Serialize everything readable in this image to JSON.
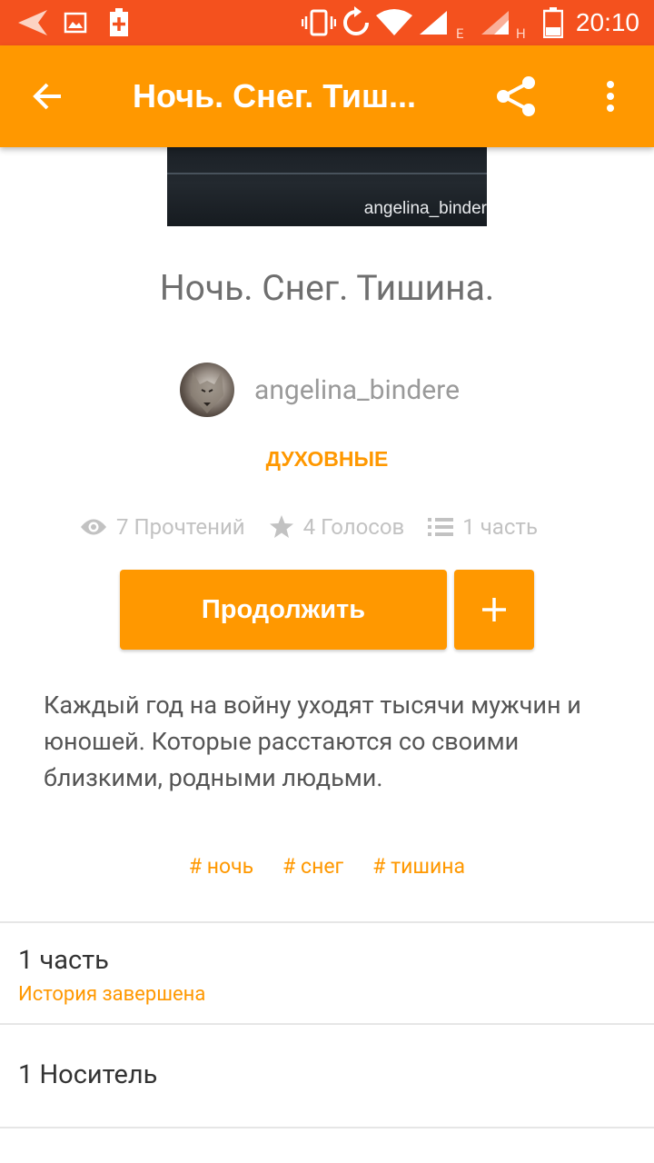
{
  "status_bar": {
    "time": "20:10",
    "network_1": "E",
    "network_2": "H"
  },
  "app_bar": {
    "title": "Ночь. Снег. Тиш..."
  },
  "cover": {
    "watermark": "angelina_binder"
  },
  "story": {
    "title": "Ночь. Снег. Тишина.",
    "author": "angelina_bindere",
    "genre": "ДУХОВНЫЕ",
    "stats": {
      "reads": "7 Прочтений",
      "votes": "4 Голосов",
      "parts": "1 часть"
    },
    "continue_label": "Продолжить",
    "description": "Каждый год на войну уходят тысячи мужчин и юношей. Которые расстаются со своими близкими, родными людьми.",
    "tags": [
      "# ночь",
      "# снег",
      "# тишина"
    ]
  },
  "details": {
    "parts_title": "1 часть",
    "parts_status": "История завершена",
    "carrier": "1 Носитель"
  },
  "colors": {
    "accent": "#ff9800",
    "status_bar": "#f4511e"
  }
}
